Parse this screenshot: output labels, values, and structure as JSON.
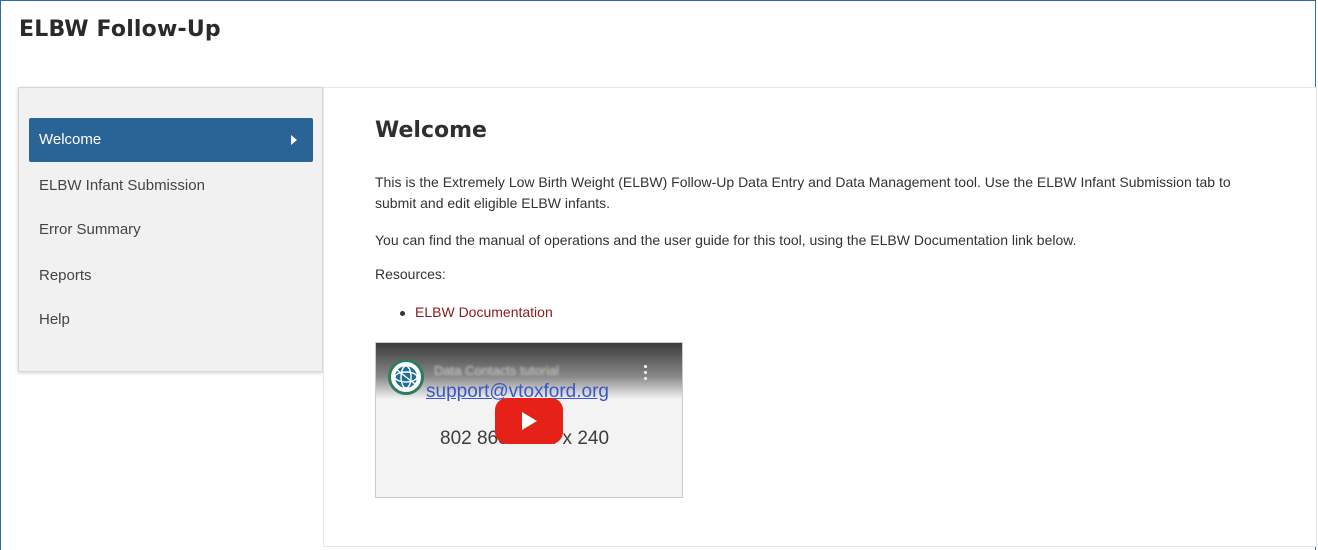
{
  "app": {
    "title": "ELBW Follow-Up"
  },
  "sidebar": {
    "items": [
      {
        "label": "Welcome",
        "active": true
      },
      {
        "label": "ELBW Infant Submission",
        "active": false
      },
      {
        "label": "Error Summary",
        "active": false
      },
      {
        "label": "Reports",
        "active": false
      },
      {
        "label": "Help",
        "active": false
      }
    ]
  },
  "content": {
    "heading": "Welcome",
    "intro": "This is the Extremely Low Birth Weight (ELBW) Follow-Up  Data Entry and Data Management tool.   Use the ELBW Infant Submission tab to submit and edit eligible ELBW infants.",
    "guide": "You can find the  manual of operations and the user guide for this tool, using the ELBW Documentation link below.",
    "resources_label": "Resources:",
    "links": [
      {
        "label": "ELBW Documentation"
      }
    ],
    "video": {
      "title": "Data Contacts tutorial",
      "email": "support@vtoxford.org",
      "phone": "802 865-4814 x 240",
      "channel_icon": "globe-logo-icon",
      "play_icon": "play-icon"
    }
  },
  "colors": {
    "accent": "#2a6496",
    "link": "#8b1a1a",
    "play": "#e62117"
  }
}
